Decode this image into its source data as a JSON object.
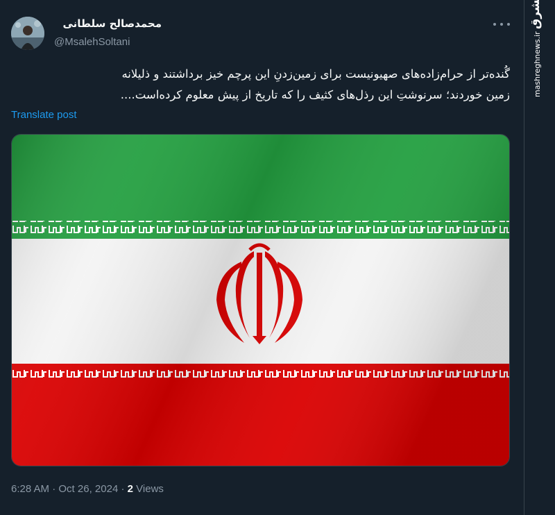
{
  "tweet": {
    "author_name": "محمدصالح سلطانی",
    "author_handle": "@MsalehSoltani",
    "text_lines": [
      "گُنده‌تر از حرام‌زاده‌های صهیونیست برای زمین‌زدنِ این پرچم خیز برداشتند و ذلیلانه",
      "زمین خوردند؛ سرنوشتِ این رذل‌های کثیف را که تاریخ از پیش معلوم کرده‌است...."
    ],
    "translate_label": "Translate post",
    "time": "6:28 AM",
    "date": "Oct 26, 2024",
    "separator": "·",
    "views_count": "2",
    "views_label": "Views"
  },
  "watermark": {
    "logo_text": "مشرق",
    "url_text": "mashreghnews.ir"
  },
  "colors": {
    "background": "#15202b",
    "text_primary": "#f7f9f9",
    "text_secondary": "#8b98a5",
    "link": "#1d9bf0",
    "flag_green": "#239f40",
    "flag_white": "#ffffff",
    "flag_red": "#da0000"
  },
  "icons": {
    "more": "more-horizontal-icon",
    "emblem": "iran-emblem"
  }
}
